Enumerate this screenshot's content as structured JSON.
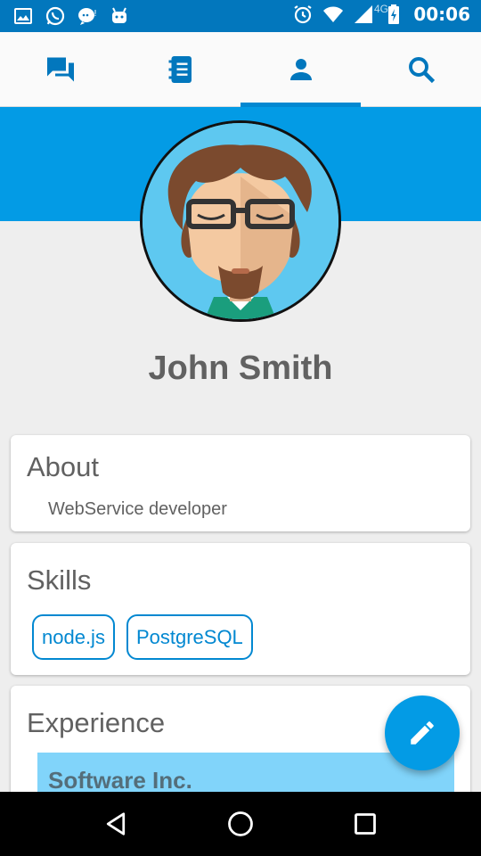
{
  "status_bar": {
    "time": "00:06",
    "network": "4G",
    "icons": [
      "gallery-icon",
      "whatsapp-icon",
      "messenger-icon",
      "android-icon",
      "alarm-icon",
      "wifi-icon",
      "signal-icon",
      "battery-charging-icon"
    ]
  },
  "tabs": [
    {
      "name": "chat",
      "icon": "chat-icon",
      "active": false
    },
    {
      "name": "notebook",
      "icon": "notebook-icon",
      "active": false
    },
    {
      "name": "profile",
      "icon": "person-icon",
      "active": true
    },
    {
      "name": "search",
      "icon": "search-icon",
      "active": false
    }
  ],
  "colors": {
    "accent": "#039be5",
    "status_bar": "#0277bd",
    "tab_icon": "#0277bd",
    "experience_item_bg": "#81d4fa"
  },
  "profile": {
    "name": "John Smith"
  },
  "about": {
    "title": "About",
    "text": "WebService developer"
  },
  "skills": {
    "title": "Skills",
    "items": [
      "node.js",
      "PostgreSQL"
    ]
  },
  "experience": {
    "title": "Experience",
    "company": "Software Inc."
  },
  "fab": {
    "icon": "edit-pencil-icon"
  },
  "nav": {
    "icons": [
      "back-icon",
      "home-icon",
      "recents-icon"
    ]
  }
}
